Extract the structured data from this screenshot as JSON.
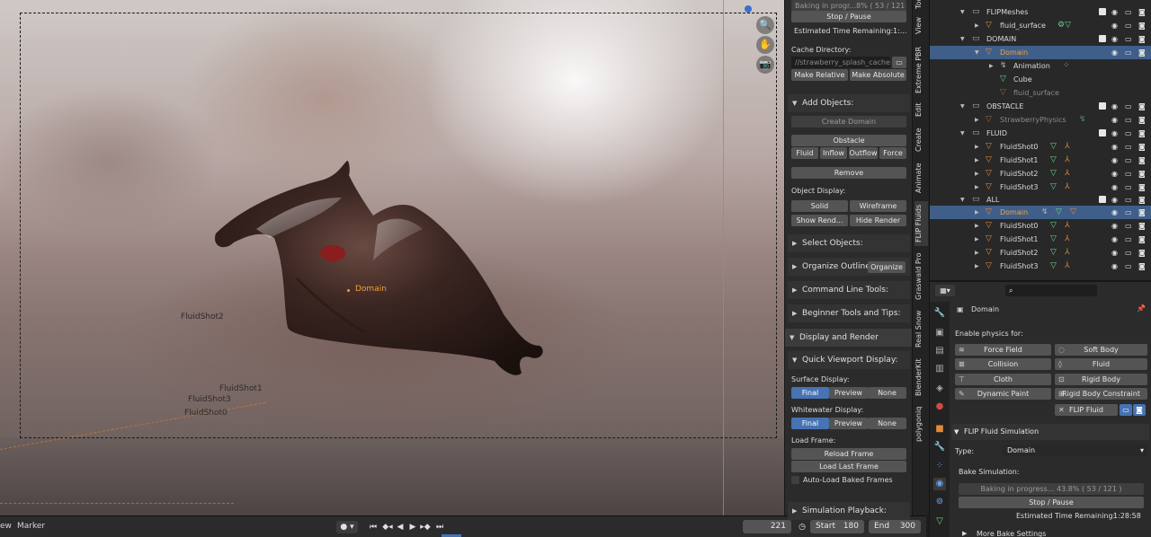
{
  "viewport": {
    "labels": {
      "domain": "Domain",
      "fluidshot2": "FluidShot2",
      "fluidshot1": "FluidShot1",
      "fluidshot3": "FluidShot3",
      "fluidshot0": "FluidShot0"
    },
    "nav_icons": {
      "zoom": "🔍",
      "hand": "✋",
      "camera": "📷"
    }
  },
  "timeline": {
    "view": "ew",
    "marker": "Marker",
    "current_frame": "221",
    "start_label": "Start",
    "start_value": "180",
    "end_label": "End",
    "end_value": "300"
  },
  "npanel": {
    "baking_status": "Baking in progr...8%  ( 53 / 121 )",
    "stop_pause": "Stop / Pause",
    "est_time": "Estimated Time Remaining:",
    "est_time_value": "1:...",
    "cache_dir_label": "Cache Directory:",
    "cache_dir_value": "//strawberry_splash_cache",
    "make_relative": "Make Relative",
    "make_absolute": "Make Absolute",
    "add_objects": "Add Objects:",
    "create_domain": "Create Domain",
    "obstacle": "Obstacle",
    "fluid": "Fluid",
    "inflow": "Inflow",
    "outflow": "Outflow",
    "force": "Force",
    "remove": "Remove",
    "object_display": "Object Display:",
    "solid": "Solid",
    "wireframe": "Wireframe",
    "show_render": "Show Rend...",
    "hide_render": "Hide Render",
    "select_objects": "Select Objects:",
    "organize_outliner": "Organize Outliner:",
    "organize": "Organize",
    "command_line_tools": "Command Line Tools:",
    "beginner_tools": "Beginner Tools and Tips:",
    "display_render": "Display and Render",
    "quick_viewport": "Quick Viewport Display:",
    "surface_display": "Surface Display:",
    "final": "Final",
    "preview": "Preview",
    "none": "None",
    "whitewater_display": "Whitewater Display:",
    "load_frame": "Load Frame:",
    "reload_frame": "Reload Frame",
    "load_last_frame": "Load Last Frame",
    "auto_load": "Auto-Load Baked Frames",
    "simulation_playback": "Simulation Playback:"
  },
  "vtabs": [
    "Tool",
    "View",
    "Extreme PBR",
    "Edit",
    "Create",
    "Animate",
    "FLIP Fluids",
    "Graswald Pro",
    "Real Snow",
    "BlenderKit",
    "polygoniq"
  ],
  "outliner": {
    "rows": [
      {
        "name": "FLIPMeshes",
        "kind": "collection"
      },
      {
        "name": "fluid_surface",
        "kind": "object"
      },
      {
        "name": "DOMAIN",
        "kind": "collection"
      },
      {
        "name": "Domain",
        "kind": "object-selected"
      },
      {
        "name": "Animation",
        "kind": "child"
      },
      {
        "name": "Cube",
        "kind": "child"
      },
      {
        "name": "fluid_surface",
        "kind": "child-dim"
      },
      {
        "name": "OBSTACLE",
        "kind": "collection"
      },
      {
        "name": "StrawberryPhysics",
        "kind": "object-dim"
      },
      {
        "name": "FLUID",
        "kind": "collection"
      },
      {
        "name": "FluidShot0",
        "kind": "object"
      },
      {
        "name": "FluidShot1",
        "kind": "object"
      },
      {
        "name": "FluidShot2",
        "kind": "object"
      },
      {
        "name": "FluidShot3",
        "kind": "object"
      },
      {
        "name": "ALL",
        "kind": "collection"
      },
      {
        "name": "Domain",
        "kind": "object-selected-hl"
      },
      {
        "name": "FluidShot0",
        "kind": "object"
      },
      {
        "name": "FluidShot1",
        "kind": "object"
      },
      {
        "name": "FluidShot2",
        "kind": "object"
      },
      {
        "name": "FluidShot3",
        "kind": "object"
      }
    ]
  },
  "props": {
    "object_name": "Domain",
    "enable_physics": "Enable physics for:",
    "force_field": "Force Field",
    "soft_body": "Soft Body",
    "collision": "Collision",
    "fluid": "Fluid",
    "cloth": "Cloth",
    "rigid_body": "Rigid Body",
    "dynamic_paint": "Dynamic Paint",
    "rigid_body_constraint": "Rigid Body Constraint",
    "flip_fluid": "FLIP Fluid",
    "flip_sim_header": "FLIP Fluid Simulation",
    "type_label": "Type:",
    "type_value": "Domain",
    "bake_sim": "Bake Simulation:",
    "baking_progress": "Baking in progress...  43.8%  ( 53 / 121 )",
    "stop_pause": "Stop / Pause",
    "est_time": "Estimated Time Remaining:",
    "est_time_value": "1:28:58",
    "more_bake": "More Bake Settings"
  },
  "colors": {
    "accent_blue": "#4772b3",
    "selection_orange": "#f2a13a",
    "panel_bg": "#2b2b2b"
  }
}
